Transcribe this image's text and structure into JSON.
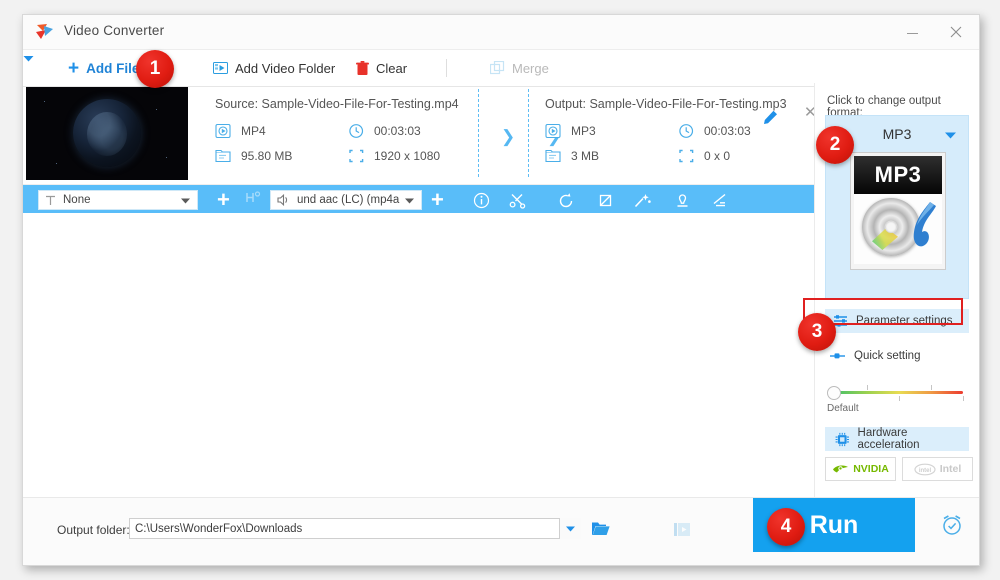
{
  "window": {
    "title": "Video Converter",
    "minimize_label": "Minimize",
    "close_label": "Close"
  },
  "toolbar": {
    "add_files": "Add Files",
    "add_files_caret": "dropdown",
    "add_video_folder": "Add Video Folder",
    "clear": "Clear",
    "merge": "Merge"
  },
  "file": {
    "source_label": "Source: Sample-Video-File-For-Testing.mp4",
    "source_format": "MP4",
    "source_duration": "00:03:03",
    "source_size": "95.80 MB",
    "source_resolution": "1920 x 1080",
    "output_label": "Output: Sample-Video-File-For-Testing.mp3",
    "output_format": "MP3",
    "output_duration": "00:03:03",
    "output_size": "3 MB",
    "output_resolution": "0 x 0"
  },
  "tracks": {
    "subtitle_value": "None",
    "audio_value": "und aac (LC) (mp4a",
    "hdr_label": "H"
  },
  "edit_tools": [
    {
      "name": "info-icon",
      "tip": "Information"
    },
    {
      "name": "cut-icon",
      "tip": "Cut"
    },
    {
      "name": "rotate-icon",
      "tip": "Rotate"
    },
    {
      "name": "crop-icon",
      "tip": "Crop"
    },
    {
      "name": "effect-icon",
      "tip": "Effects"
    },
    {
      "name": "watermark-icon",
      "tip": "Watermark"
    },
    {
      "name": "subtitle-icon",
      "tip": "Subtitle"
    }
  ],
  "right_panel": {
    "prompt": "Click to change output format:",
    "format_name": "MP3",
    "format_thumb_label": "MP3",
    "parameter_settings": "Parameter settings",
    "quick_setting": "Quick setting",
    "slider_default_label": "Default",
    "slider_value": 0,
    "hardware_acceleration": "Hardware acceleration",
    "gpu_nvidia": "NVIDIA",
    "gpu_intel": "Intel"
  },
  "bottom": {
    "output_folder_label": "Output folder:",
    "output_folder_path": "C:\\Users\\WonderFox\\Downloads",
    "open_folder_icon": "folder-icon",
    "batch_icon": "batch-icon",
    "run_label": "Run",
    "schedule_icon": "alarm-icon"
  },
  "steps": {
    "one": "1",
    "two": "2",
    "three": "3",
    "four": "4"
  },
  "colors": {
    "accent_blue": "#14a1ef",
    "strip_blue": "#59bdf9",
    "badge_red": "#e01c12",
    "highlight_red": "#e02020",
    "panel_blue": "#d6ecfb"
  }
}
